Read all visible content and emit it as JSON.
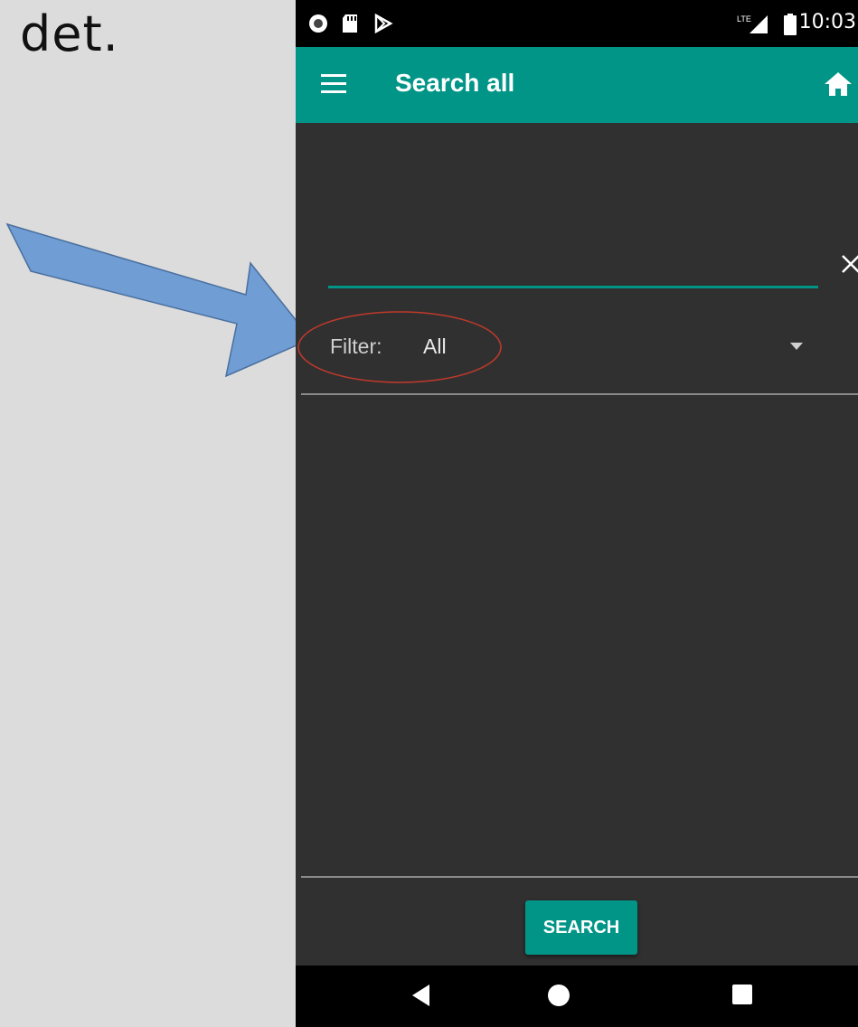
{
  "caption": "det.",
  "status_bar": {
    "time": "10:03",
    "network": "LTE"
  },
  "app_bar": {
    "title": "Search all",
    "menu_icon": "hamburger-menu-icon",
    "home_icon": "home-icon"
  },
  "search": {
    "value": "",
    "placeholder": "",
    "clear_icon": "close-icon"
  },
  "filter": {
    "label": "Filter:",
    "selected": "All",
    "dropdown_icon": "caret-down-icon"
  },
  "actions": {
    "search_button": "SEARCH"
  },
  "colors": {
    "accent": "#009587",
    "background": "#303030",
    "annotation_arrow": "#6f9dd4",
    "annotation_ellipse": "#c0392b"
  },
  "nav_bar": {
    "icons": [
      "back-icon",
      "home-circle-icon",
      "recents-icon"
    ]
  }
}
